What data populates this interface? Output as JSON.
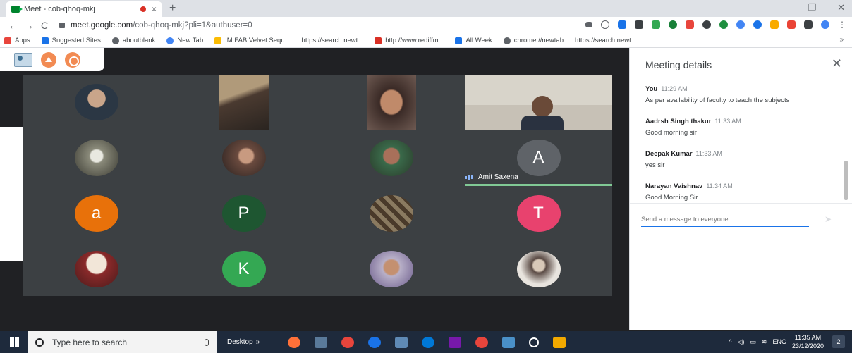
{
  "browser": {
    "tab_title": "Meet - cob-qhoq-mkj",
    "tab_close": "×",
    "new_tab": "+",
    "url_domain": "meet.google.com",
    "url_rest": "/cob-qhoq-mkj?pli=1&authuser=0",
    "win_minimize": "—",
    "win_restore": "❐",
    "win_close": "✕",
    "back": "←",
    "forward": "→",
    "reload": "C",
    "bookmarks": [
      {
        "label": "Apps",
        "color": "#e8453c"
      },
      {
        "label": "Suggested Sites",
        "color": "#1a73e8"
      },
      {
        "label": "aboutblank",
        "color": "#5f6368"
      },
      {
        "label": "New Tab",
        "color": "#4285f4"
      },
      {
        "label": "IM FAB Velvet Sequ...",
        "color": "#fbbc04"
      },
      {
        "label": "https://search.newt...",
        "color": "#ffffff"
      },
      {
        "label": "http://www.rediffm...",
        "color": "#d93025"
      },
      {
        "label": "All Week",
        "color": "#1a73e8"
      },
      {
        "label": "chrome://newtab",
        "color": "#5f6368"
      },
      {
        "label": "https://search.newt...",
        "color": "#ffffff"
      }
    ],
    "bookmarks_more": "»"
  },
  "grid": {
    "tiles": [
      {
        "row": 0,
        "col": 0,
        "kind": "photo",
        "color": "#3a4a5c"
      },
      {
        "row": 0,
        "col": 1,
        "kind": "video",
        "color": "#7a6a55"
      },
      {
        "row": 0,
        "col": 2,
        "kind": "video",
        "color": "#8a6a5a"
      },
      {
        "row": 0,
        "col": 3,
        "kind": "video",
        "color": "#c9c4ba"
      },
      {
        "row": 1,
        "col": 0,
        "kind": "photo",
        "color": "#6a6a5a"
      },
      {
        "row": 1,
        "col": 1,
        "kind": "photo",
        "color": "#5a4a42"
      },
      {
        "row": 1,
        "col": 2,
        "kind": "photo",
        "color": "#7a5040"
      },
      {
        "row": 2,
        "col": 0,
        "kind": "letter",
        "letter": "a",
        "color": "#e8710a"
      },
      {
        "row": 2,
        "col": 1,
        "kind": "letter",
        "letter": "P",
        "color": "#1e5631"
      },
      {
        "row": 2,
        "col": 2,
        "kind": "photo",
        "color": "#6e5a48"
      },
      {
        "row": 2,
        "col": 3,
        "kind": "letter",
        "letter": "T",
        "color": "#e8426e"
      },
      {
        "row": 3,
        "col": 0,
        "kind": "photo",
        "color": "#8a2a2a"
      },
      {
        "row": 3,
        "col": 1,
        "kind": "letter",
        "letter": "K",
        "color": "#34a853"
      },
      {
        "row": 3,
        "col": 2,
        "kind": "photo",
        "color": "#7a6a8a"
      },
      {
        "row": 3,
        "col": 3,
        "kind": "photo",
        "color": "#5a5550"
      }
    ],
    "amit": {
      "letter": "A",
      "name": "Amit Saxena",
      "color": "#5f6368"
    }
  },
  "panel": {
    "title": "Meeting details",
    "close": "✕",
    "messages": [
      {
        "who": "You",
        "time": "11:29 AM",
        "text": "As per availability of faculty to teach the subjects"
      },
      {
        "who": "Aadrsh Singh thakur",
        "time": "11:33 AM",
        "text": "Good morning sir"
      },
      {
        "who": "Deepak Kumar",
        "time": "11:33 AM",
        "text": "yes sir"
      },
      {
        "who": "Narayan Vaishnav",
        "time": "11:34 AM",
        "text": "Good Morning Sir"
      }
    ],
    "input_placeholder": "Send a message to everyone",
    "send_icon": "➤"
  },
  "taskbar": {
    "search_placeholder": "Type here to search",
    "desktop_label": "Desktop",
    "desktop_more": "»",
    "language": "ENG",
    "time": "11:35 AM",
    "date": "23/12/2020",
    "notification_count": "2"
  }
}
